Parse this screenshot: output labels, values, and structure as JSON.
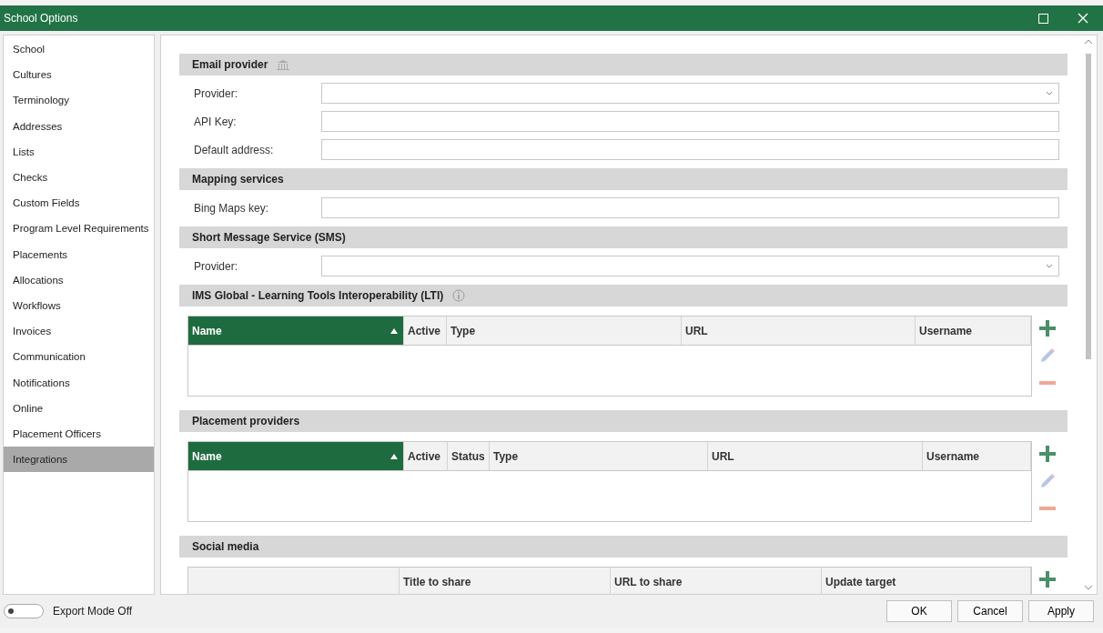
{
  "window": {
    "title": "School Options"
  },
  "sidebar": {
    "items": [
      {
        "label": "School",
        "selected": false
      },
      {
        "label": "Cultures",
        "selected": false
      },
      {
        "label": "Terminology",
        "selected": false
      },
      {
        "label": "Addresses",
        "selected": false
      },
      {
        "label": "Lists",
        "selected": false
      },
      {
        "label": "Checks",
        "selected": false
      },
      {
        "label": "Custom Fields",
        "selected": false
      },
      {
        "label": "Program Level Requirements",
        "selected": false
      },
      {
        "label": "Placements",
        "selected": false
      },
      {
        "label": "Allocations",
        "selected": false
      },
      {
        "label": "Workflows",
        "selected": false
      },
      {
        "label": "Invoices",
        "selected": false
      },
      {
        "label": "Communication",
        "selected": false
      },
      {
        "label": "Notifications",
        "selected": false
      },
      {
        "label": "Online",
        "selected": false
      },
      {
        "label": "Placement Officers",
        "selected": false
      },
      {
        "label": "Integrations",
        "selected": true
      }
    ]
  },
  "sections": [
    {
      "title": "Email provider",
      "kind": "fields",
      "fields": [
        {
          "label": "Provider:",
          "kind": "dropdown"
        },
        {
          "label": "API Key:",
          "kind": "text"
        },
        {
          "label": "Default address:",
          "kind": "text"
        }
      ]
    },
    {
      "title": "Mapping services",
      "kind": "fields",
      "fields": [
        {
          "label": "Bing Maps key:",
          "kind": "text"
        }
      ]
    },
    {
      "title": "Short Message Service (SMS)",
      "kind": "fields",
      "fields": [
        {
          "label": "Provider:",
          "kind": "dropdown"
        }
      ]
    },
    {
      "title": "IMS Global - Learning Tools Interoperability (LTI)",
      "kind": "table",
      "columns": [
        {
          "label": "Name",
          "sorted": true
        },
        {
          "label": "Active",
          "sorted": false
        },
        {
          "label": "Type",
          "sorted": false
        },
        {
          "label": "URL",
          "sorted": false
        },
        {
          "label": "Username",
          "sorted": false
        }
      ]
    },
    {
      "title": "Placement providers",
      "kind": "table",
      "columns": [
        {
          "label": "Name",
          "sorted": true
        },
        {
          "label": "Active",
          "sorted": false
        },
        {
          "label": "Status",
          "sorted": false
        },
        {
          "label": "Type",
          "sorted": false
        },
        {
          "label": "URL",
          "sorted": false
        },
        {
          "label": "Username",
          "sorted": false
        }
      ]
    },
    {
      "title": "Social media",
      "kind": "table",
      "columns": [
        {
          "sorted": false
        },
        {
          "label": "Title to share",
          "sorted": false
        },
        {
          "label": "URL to share",
          "sorted": false
        },
        {
          "label": "Update target",
          "sorted": false
        }
      ]
    }
  ],
  "footer": {
    "export_mode": {
      "label": "Export Mode Off",
      "on": false
    },
    "buttons": [
      "OK",
      "Cancel",
      "Apply"
    ]
  }
}
